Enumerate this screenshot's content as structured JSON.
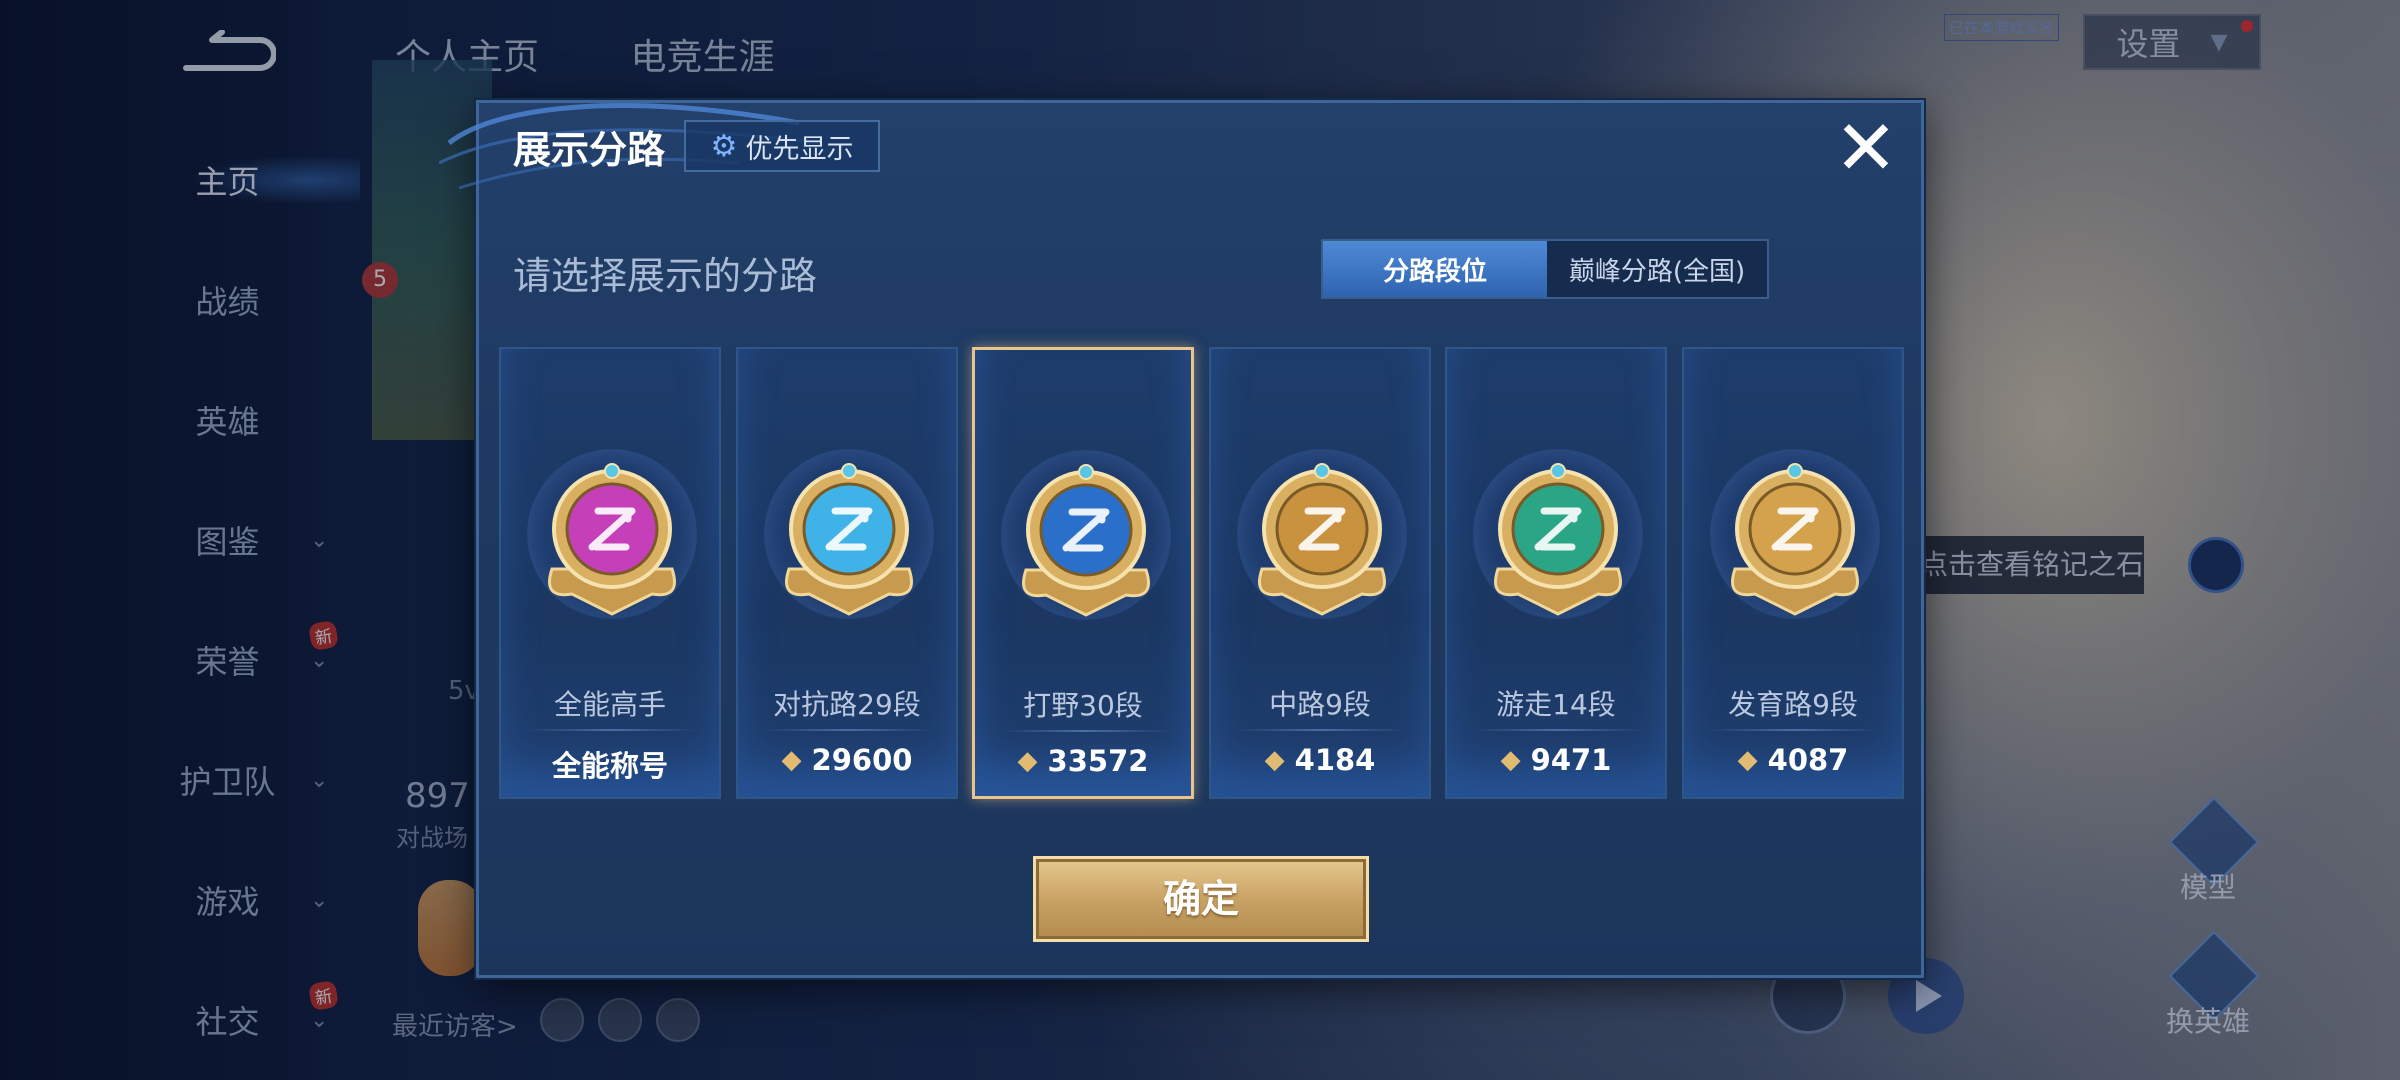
{
  "sidebar": {
    "items": [
      {
        "label": "主页",
        "active": true
      },
      {
        "label": "战绩"
      },
      {
        "label": "英雄"
      },
      {
        "label": "图鉴",
        "chevron": true
      },
      {
        "label": "荣誉",
        "chevron": true,
        "badge": "新"
      },
      {
        "label": "护卫队",
        "chevron": true
      },
      {
        "label": "游戏",
        "chevron": true
      },
      {
        "label": "社交",
        "chevron": true,
        "badge": "新"
      }
    ]
  },
  "top_tabs": [
    "个人主页",
    "电竞生涯"
  ],
  "top_small_label": "已在本游戏实名",
  "settings_label": "设置",
  "profile": {
    "notification_count": "5",
    "stat_short": "5v",
    "stat_number": "897",
    "stat_label": "对战场",
    "recent_visitors_label": "最近访客>"
  },
  "right_panel": {
    "inscription_tip": "点击查看铭记之石",
    "model_label": "模型",
    "swap_label": "换英雄"
  },
  "modal": {
    "title": "展示分路",
    "priority_button": "优先显示",
    "prompt": "请选择展示的分路",
    "tabs": [
      {
        "label": "分路段位",
        "active": true
      },
      {
        "label": "巅峰分路(全国)",
        "active": false
      }
    ],
    "cards": [
      {
        "lane": "全能高手",
        "score": "全能称号",
        "has_score_icon": false,
        "emblem_color": "#c43fb8",
        "selected": false
      },
      {
        "lane": "对抗路29段",
        "score": "29600",
        "has_score_icon": true,
        "emblem_color": "#3fb3e8",
        "selected": false
      },
      {
        "lane": "打野30段",
        "score": "33572",
        "has_score_icon": true,
        "emblem_color": "#2a6fc9",
        "selected": true
      },
      {
        "lane": "中路9段",
        "score": "4184",
        "has_score_icon": true,
        "emblem_color": "#c8923f",
        "selected": false
      },
      {
        "lane": "游走14段",
        "score": "9471",
        "has_score_icon": true,
        "emblem_color": "#2aa586",
        "selected": false
      },
      {
        "lane": "发育路9段",
        "score": "4087",
        "has_score_icon": true,
        "emblem_color": "#d4a14c",
        "selected": false
      }
    ],
    "confirm_button": "确定"
  },
  "colors": {
    "accent_gold": "#e9c48b",
    "tab_active": "#3f7acc",
    "modal_bg": "#1f3b63"
  }
}
